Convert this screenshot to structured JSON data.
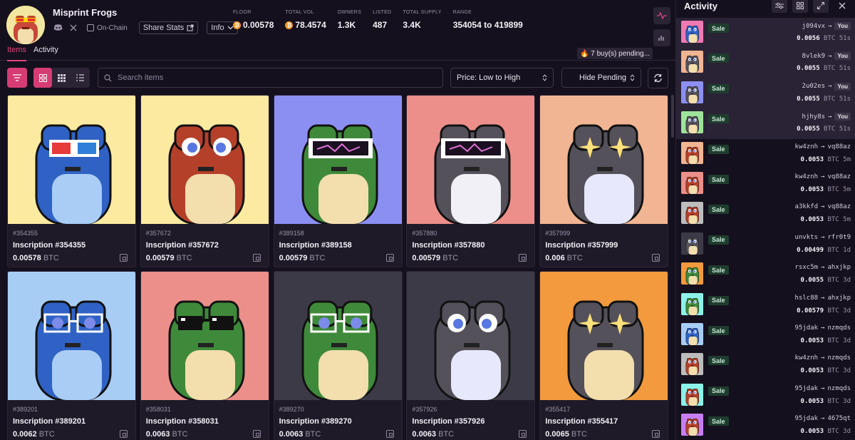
{
  "collection": {
    "name": "Misprint Frogs",
    "onchain_label": "On-Chain",
    "share_label": "Share Stats",
    "info_label": "Info",
    "avatar_color": "#f1e7a0"
  },
  "stats": [
    {
      "label": "FLOOR",
      "value": "0.00578",
      "btc": true
    },
    {
      "label": "TOTAL VOL",
      "value": "78.4574",
      "btc": true
    },
    {
      "label": "OWNERS",
      "value": "1.3K",
      "btc": false
    },
    {
      "label": "LISTED",
      "value": "487",
      "btc": false
    },
    {
      "label": "TOTAL SUPPLY",
      "value": "3.4K",
      "btc": false
    },
    {
      "label": "RANGE",
      "value": "354054 to 419899",
      "btc": false
    }
  ],
  "tabs": {
    "items": "Items",
    "activity": "Activity"
  },
  "pending": "🔥 7 buy(s) pending...",
  "toolbar": {
    "search_placeholder": "Search items",
    "sort_label": "Price: Low to High",
    "pending_filter_label": "Hide Pending"
  },
  "grid": [
    {
      "num": "#354355",
      "title": "Inscription #354355",
      "price": "0.00578",
      "unit": "BTC",
      "bg": "#fbeaa0",
      "body": "#2f62c4",
      "belly": "#a9cdf5",
      "glasses": "3d"
    },
    {
      "num": "#357672",
      "title": "Inscription #357672",
      "price": "0.00579",
      "unit": "BTC",
      "bg": "#fbeaa0",
      "body": "#b5402a",
      "belly": "#f3deae",
      "glasses": "eyes"
    },
    {
      "num": "#389158",
      "title": "Inscription #389158",
      "price": "0.00579",
      "unit": "BTC",
      "bg": "#8c8ff2",
      "body": "#3f8a3a",
      "belly": "#f3deae",
      "glasses": "visor"
    },
    {
      "num": "#357880",
      "title": "Inscription #357880",
      "price": "0.00579",
      "unit": "BTC",
      "bg": "#ec8f8a",
      "body": "#54515a",
      "belly": "#f1f0f7",
      "glasses": "visor"
    },
    {
      "num": "#357999",
      "title": "Inscription #357999",
      "price": "0.006",
      "unit": "BTC",
      "bg": "#f1b593",
      "body": "#54515a",
      "belly": "#e7e8fb",
      "glasses": "stars"
    },
    {
      "num": "#389201",
      "title": "Inscription #389201",
      "price": "0.0062",
      "unit": "BTC",
      "bg": "#a8cdf5",
      "body": "#2f62c4",
      "belly": "#a9cdf5",
      "glasses": "specs"
    },
    {
      "num": "#358031",
      "title": "Inscription #358031",
      "price": "0.0063",
      "unit": "BTC",
      "bg": "#ec8f8a",
      "body": "#3f8a3a",
      "belly": "#f3deae",
      "glasses": "shades"
    },
    {
      "num": "#389270",
      "title": "Inscription #389270",
      "price": "0.0063",
      "unit": "BTC",
      "bg": "#3d3a48",
      "body": "#3f8a3a",
      "belly": "#f3deae",
      "glasses": "specs"
    },
    {
      "num": "#357926",
      "title": "Inscription #357926",
      "price": "0.0063",
      "unit": "BTC",
      "bg": "#3d3a48",
      "body": "#54515a",
      "belly": "#e7e8fb",
      "glasses": "eyes"
    },
    {
      "num": "#355417",
      "title": "Inscription #355417",
      "price": "0.0065",
      "unit": "BTC",
      "bg": "#f29a3d",
      "body": "#54515a",
      "belly": "#f3deae",
      "glasses": "stars"
    }
  ],
  "activity": {
    "title": "Activity",
    "rows": [
      {
        "type": "Sale",
        "from": "j094vx",
        "to": "You",
        "you": true,
        "price": "0.0056",
        "unit": "BTC",
        "time": "51s",
        "bg": "#f07ab3",
        "body": "#2f62c4"
      },
      {
        "type": "Sale",
        "from": "8vlek9",
        "to": "You",
        "you": true,
        "price": "0.0055",
        "unit": "BTC",
        "time": "51s",
        "bg": "#f1b593",
        "body": "#54515a"
      },
      {
        "type": "Sale",
        "from": "2u02es",
        "to": "You",
        "you": true,
        "price": "0.0055",
        "unit": "BTC",
        "time": "51s",
        "bg": "#8c8ff2",
        "body": "#54515a"
      },
      {
        "type": "Sale",
        "from": "hjhy8s",
        "to": "You",
        "you": true,
        "price": "0.0055",
        "unit": "BTC",
        "time": "51s",
        "bg": "#9ee39a",
        "body": "#54515a"
      },
      {
        "type": "Sale",
        "from": "kw4znh",
        "to": "vq88az",
        "you": false,
        "price": "0.0053",
        "unit": "BTC",
        "time": "5m",
        "bg": "#f1b593",
        "body": "#b5402a"
      },
      {
        "type": "Sale",
        "from": "kw4znh",
        "to": "vq88az",
        "you": false,
        "price": "0.0053",
        "unit": "BTC",
        "time": "5m",
        "bg": "#ec8f8a",
        "body": "#b5402a"
      },
      {
        "type": "Sale",
        "from": "a3kkfd",
        "to": "vq88az",
        "you": false,
        "price": "0.0053",
        "unit": "BTC",
        "time": "5m",
        "bg": "#bdbdbd",
        "body": "#b5402a"
      },
      {
        "type": "Sale",
        "from": "unvkts",
        "to": "rfr0t9",
        "you": false,
        "price": "0.00499",
        "unit": "BTC",
        "time": "1d",
        "bg": "#3d3a48",
        "body": "#54515a"
      },
      {
        "type": "Sale",
        "from": "rsxc5m",
        "to": "ahxjkp",
        "you": false,
        "price": "0.0055",
        "unit": "BTC",
        "time": "3d",
        "bg": "#f29a3d",
        "body": "#3f8a3a"
      },
      {
        "type": "Sale",
        "from": "hslc88",
        "to": "ahxjkp",
        "you": false,
        "price": "0.00579",
        "unit": "BTC",
        "time": "3d",
        "bg": "#8cf2e8",
        "body": "#3f8a3a"
      },
      {
        "type": "Sale",
        "from": "95jdak",
        "to": "nzmqds",
        "you": false,
        "price": "0.0053",
        "unit": "BTC",
        "time": "3d",
        "bg": "#a8cdf5",
        "body": "#2f62c4"
      },
      {
        "type": "Sale",
        "from": "kw4znh",
        "to": "nzmqds",
        "you": false,
        "price": "0.0053",
        "unit": "BTC",
        "time": "3d",
        "bg": "#bdbdbd",
        "body": "#b5402a"
      },
      {
        "type": "Sale",
        "from": "95jdak",
        "to": "nzmqds",
        "you": false,
        "price": "0.0053",
        "unit": "BTC",
        "time": "3d",
        "bg": "#8cf2e8",
        "body": "#b5402a"
      },
      {
        "type": "Sale",
        "from": "95jdak",
        "to": "4675qt",
        "you": false,
        "price": "0.0053",
        "unit": "BTC",
        "time": "3d",
        "bg": "#c77ef2",
        "body": "#b5402a"
      }
    ]
  },
  "colors": {
    "accent": "#d63c74",
    "bg": "#15101d",
    "card": "#1f1a27"
  }
}
